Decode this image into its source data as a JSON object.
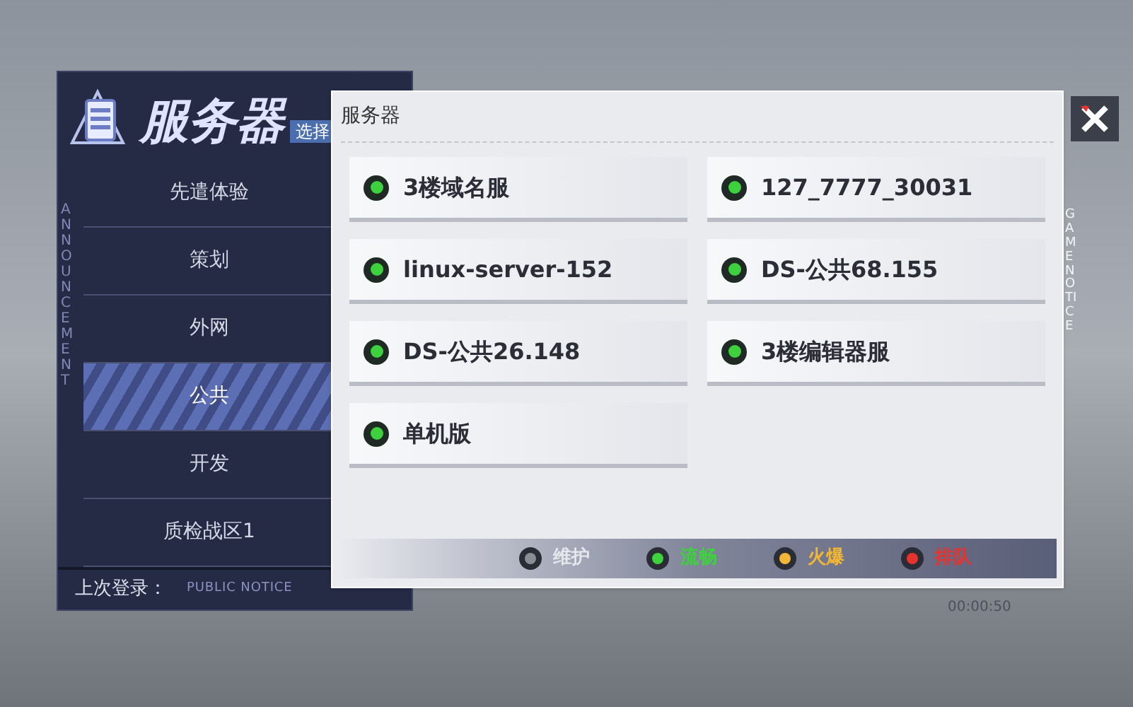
{
  "header": {
    "title": "服务器",
    "badge": "选择"
  },
  "sidebar": {
    "items": [
      {
        "label": "先遣体验",
        "selected": false
      },
      {
        "label": "策划",
        "selected": false
      },
      {
        "label": "外网",
        "selected": false
      },
      {
        "label": "公共",
        "selected": true
      },
      {
        "label": "开发",
        "selected": false
      },
      {
        "label": "质检战区1",
        "selected": false
      }
    ],
    "last_login": "上次登录：",
    "side_caption": "ANNOUNCEMENT",
    "footer_caption": "PUBLIC NOTICE"
  },
  "panel": {
    "title": "服务器",
    "side_caption": "GAME NOTICE",
    "timer": "00:00:50",
    "servers": [
      {
        "name": "3楼域名服",
        "color": "#3ed13e"
      },
      {
        "name": "127_7777_30031",
        "color": "#3ed13e"
      },
      {
        "name": "linux-server-152",
        "color": "#3ed13e"
      },
      {
        "name": "DS-公共68.155",
        "color": "#3ed13e"
      },
      {
        "name": "DS-公共26.148",
        "color": "#3ed13e"
      },
      {
        "name": "3楼编辑器服",
        "color": "#3ed13e"
      },
      {
        "name": "单机版",
        "color": "#3ed13e"
      }
    ],
    "legend": [
      {
        "label": "维护",
        "color": "#8a8d96"
      },
      {
        "label": "流畅",
        "color": "#3ed13e"
      },
      {
        "label": "火爆",
        "color": "#f2b637"
      },
      {
        "label": "排队",
        "color": "#e8322e"
      }
    ]
  }
}
